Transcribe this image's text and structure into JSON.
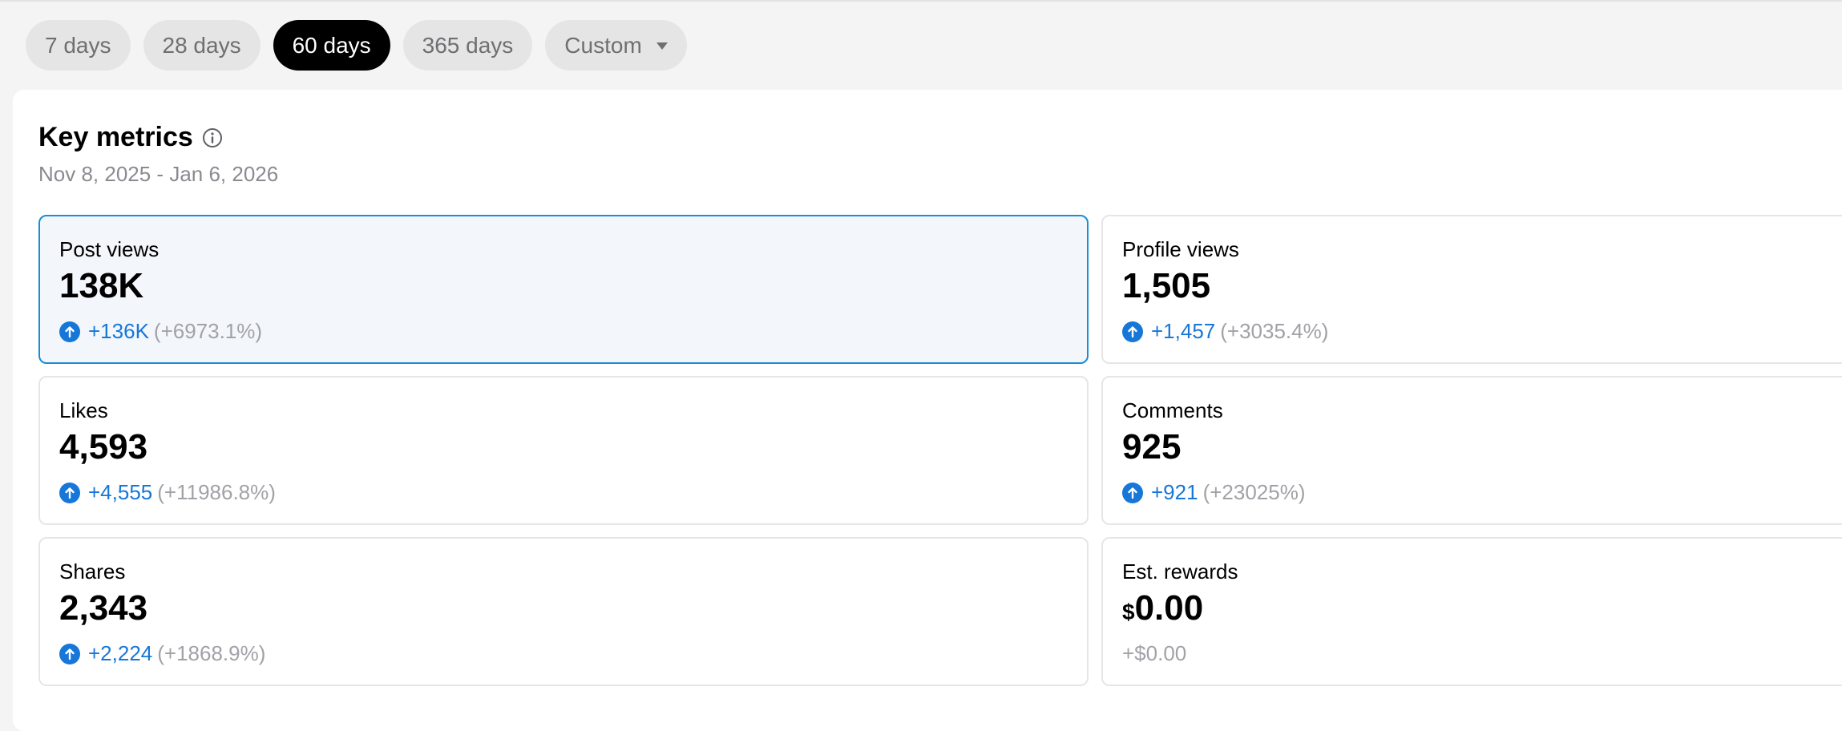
{
  "filters": [
    {
      "label": "7 days",
      "active": false
    },
    {
      "label": "28 days",
      "active": false
    },
    {
      "label": "60 days",
      "active": true
    },
    {
      "label": "365 days",
      "active": false
    },
    {
      "label": "Custom",
      "active": false,
      "icon": "caret-down-icon"
    }
  ],
  "header": {
    "title": "Key metrics",
    "info_icon": "info-icon",
    "date_range": "Nov 8, 2025 - Jan 6, 2026"
  },
  "metrics": [
    {
      "label": "Post views",
      "value": "138K",
      "delta": "+136K",
      "pct": "(+6973.1%)",
      "selected": true
    },
    {
      "label": "Profile views",
      "value": "1,505",
      "delta": "+1,457",
      "pct": "(+3035.4%)"
    },
    {
      "label": "Likes",
      "value": "4,593",
      "delta": "+4,555",
      "pct": "(+11986.8%)"
    },
    {
      "label": "Comments",
      "value": "925",
      "delta": "+921",
      "pct": "(+23025%)"
    },
    {
      "label": "Shares",
      "value": "2,343",
      "delta": "+2,224",
      "pct": "(+1868.9%)"
    },
    {
      "label": "Est. rewards",
      "currency": "$",
      "value": "0.00",
      "delta": "+$0.00"
    }
  ],
  "colors": {
    "accent": "#1677d9",
    "selected_border": "#1a8cd8",
    "selected_bg": "#f3f7fc",
    "active_pill": "#000000"
  }
}
